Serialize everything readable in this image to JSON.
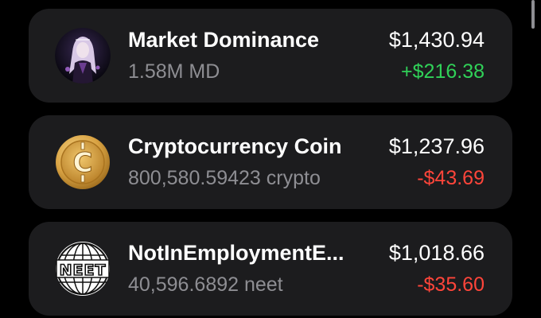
{
  "colors": {
    "card_background": "#1c1c1e",
    "primary_text": "#ffffff",
    "secondary_text": "#8e8e93",
    "positive": "#30d158",
    "negative": "#ff453a"
  },
  "tokens": [
    {
      "name": "Market Dominance",
      "balance": "1.58M MD",
      "value": "$1,430.94",
      "change": "+$216.38",
      "change_direction": "positive",
      "icon": "market-dominance-avatar-icon"
    },
    {
      "name": "Cryptocurrency Coin",
      "balance": "800,580.59423 crypto",
      "value": "$1,237.96",
      "change": "-$43.69",
      "change_direction": "negative",
      "icon": "gold-c-coin-icon"
    },
    {
      "name": "NotInEmploymentE...",
      "balance": "40,596.6892 neet",
      "value": "$1,018.66",
      "change": "-$35.60",
      "change_direction": "negative",
      "icon": "neet-globe-icon"
    }
  ]
}
